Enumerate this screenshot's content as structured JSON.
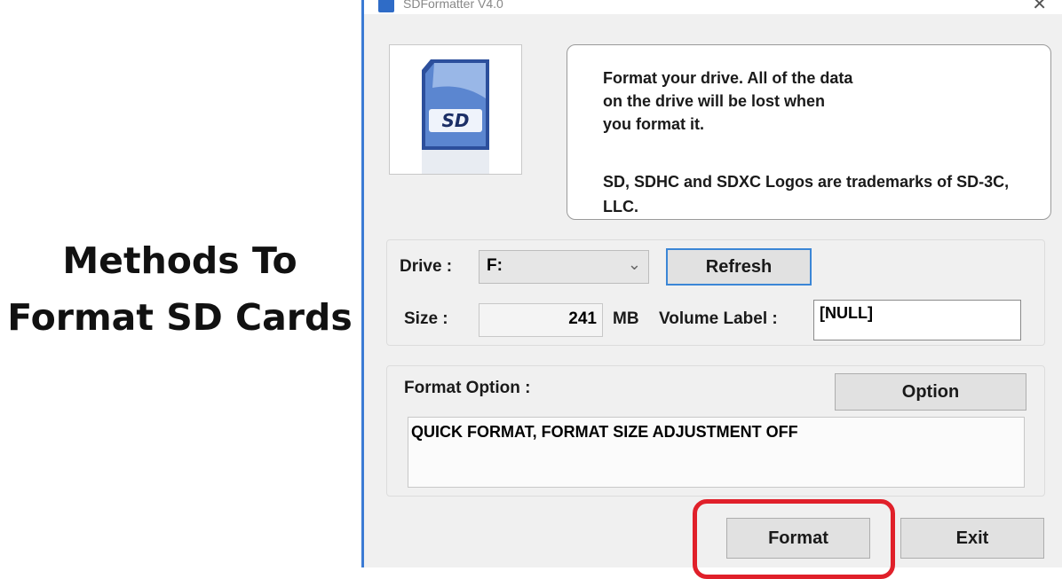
{
  "headline": {
    "line1": "Methods To",
    "line2": "Format SD Cards"
  },
  "window": {
    "title": "SDFormatter V4.0",
    "close": "✕"
  },
  "info": {
    "text": "Format your drive. All of the data\non the drive will be lost when\nyou format it.",
    "trademark": "SD, SDHC and SDXC Logos are trademarks of SD-3C, LLC."
  },
  "drive": {
    "label": "Drive :",
    "value": "F:",
    "refresh": "Refresh"
  },
  "size": {
    "label": "Size :",
    "value": "241",
    "unit": "MB",
    "volume_label": "Volume Label :",
    "volume_value": "[NULL]"
  },
  "format_option": {
    "label": "Format Option :",
    "option_button": "Option",
    "current": "QUICK FORMAT, FORMAT SIZE ADJUSTMENT OFF"
  },
  "actions": {
    "format": "Format",
    "exit": "Exit"
  },
  "colors": {
    "highlight": "#e0202a",
    "accent": "#3b86d6"
  }
}
